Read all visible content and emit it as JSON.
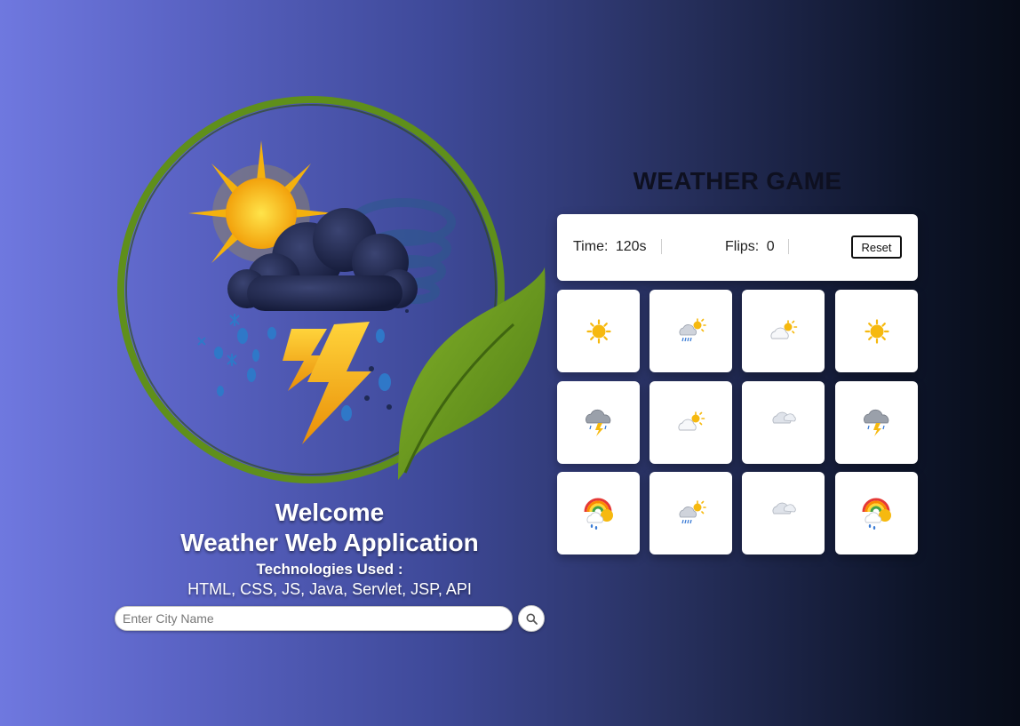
{
  "welcome": {
    "title": "Welcome",
    "app_name": "Weather Web Application",
    "tech_label": "Technologies Used :",
    "tech_list": "HTML, CSS, JS, Java, Servlet, JSP, API"
  },
  "search": {
    "placeholder": "Enter City Name",
    "value": "",
    "button_icon": "search-icon"
  },
  "game": {
    "title": "WEATHER GAME",
    "time_label": "Time:",
    "time_value": "120s",
    "flips_label": "Flips:",
    "flips_value": "0",
    "reset_label": "Reset"
  },
  "cards": [
    {
      "icon": "sun-icon"
    },
    {
      "icon": "sun-cloud-rain-icon"
    },
    {
      "icon": "sun-behind-cloud-icon"
    },
    {
      "icon": "sun-icon"
    },
    {
      "icon": "thunder-cloud-icon"
    },
    {
      "icon": "sun-behind-cloud-icon"
    },
    {
      "icon": "cloud-icon"
    },
    {
      "icon": "thunder-cloud-icon"
    },
    {
      "icon": "rainbow-icon"
    },
    {
      "icon": "sun-cloud-rain-icon"
    },
    {
      "icon": "cloud-icon"
    },
    {
      "icon": "rainbow-icon"
    }
  ],
  "colors": {
    "accent_green": "#6a9a1f",
    "sun_yellow": "#f6b90f",
    "storm_cloud": "#262d57",
    "card_bg": "#ffffff",
    "title_dark": "#0e1020"
  }
}
